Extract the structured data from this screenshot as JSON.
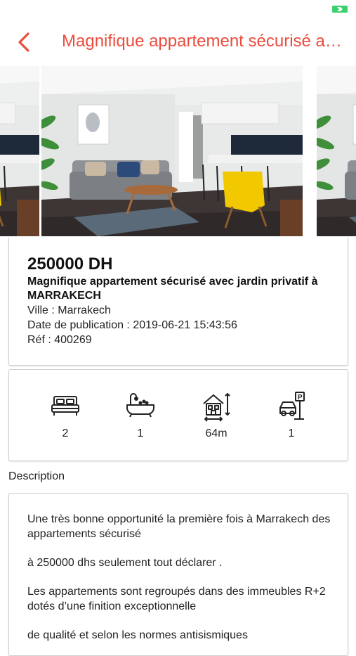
{
  "nav": {
    "title": "Magnifique appartement sécurisé avec jardin privatif à MARRAKECH",
    "back_icon": "chevron-left-icon",
    "accent_color": "#ea4c3d"
  },
  "gallery": {
    "images": [
      "living-room-photo",
      "living-room-photo",
      "living-room-photo"
    ]
  },
  "listing": {
    "price": "250000 DH",
    "title": "Magnifique appartement sécurisé avec jardin privatif à MARRAKECH",
    "city": "Ville : Marrakech",
    "date": "Date de publication : 2019-06-21 15:43:56",
    "ref": "Réf : 400269"
  },
  "features": [
    {
      "icon": "bed-icon",
      "value": "2"
    },
    {
      "icon": "bathtub-icon",
      "value": "1"
    },
    {
      "icon": "house-area-icon",
      "value": "64m"
    },
    {
      "icon": "parking-icon",
      "value": "1"
    }
  ],
  "description": {
    "label": "Description",
    "paragraphs": [
      "Une très bonne opportunité la première fois à Marrakech des appartements sécurisé",
      "à 250000 dhs seulement tout déclarer .",
      "Les appartements sont regroupés dans des immeubles R+2 dotés d’une finition exceptionnelle",
      "de qualité et selon les normes antisismiques"
    ]
  }
}
